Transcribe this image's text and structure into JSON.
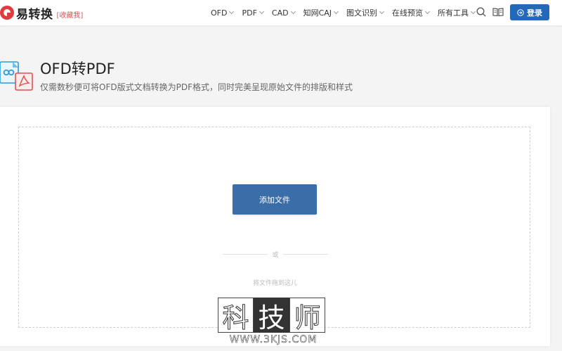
{
  "header": {
    "logo_text": "易转换",
    "favorite_label": "[收藏我]",
    "nav": [
      {
        "label": "OFD"
      },
      {
        "label": "PDF"
      },
      {
        "label": "CAD"
      },
      {
        "label": "知网CAJ"
      },
      {
        "label": "图文识别"
      },
      {
        "label": "在线预览"
      },
      {
        "label": "所有工具"
      }
    ],
    "login_label": "登录",
    "icons": [
      "search-icon",
      "book-icon",
      "login-icon",
      "chevron-down-icon"
    ],
    "accent_color": "#2468b8",
    "brand_color": "#e23b3b"
  },
  "hero": {
    "title": "OFD转PDF",
    "subtitle": "仅需数秒便可将OFD版式文档转换为PDF格式，同时完美呈现原始文件的排版和样式",
    "icon": "ofd-to-pdf-icon"
  },
  "upload": {
    "add_button_label": "添加文件",
    "or_text": "或",
    "drop_hint": "将文件拖到这儿",
    "button_color": "#3b6ea8"
  },
  "watermark": {
    "chars": [
      "科",
      "技",
      "师"
    ],
    "url": "WWW.3KJS.COM"
  }
}
